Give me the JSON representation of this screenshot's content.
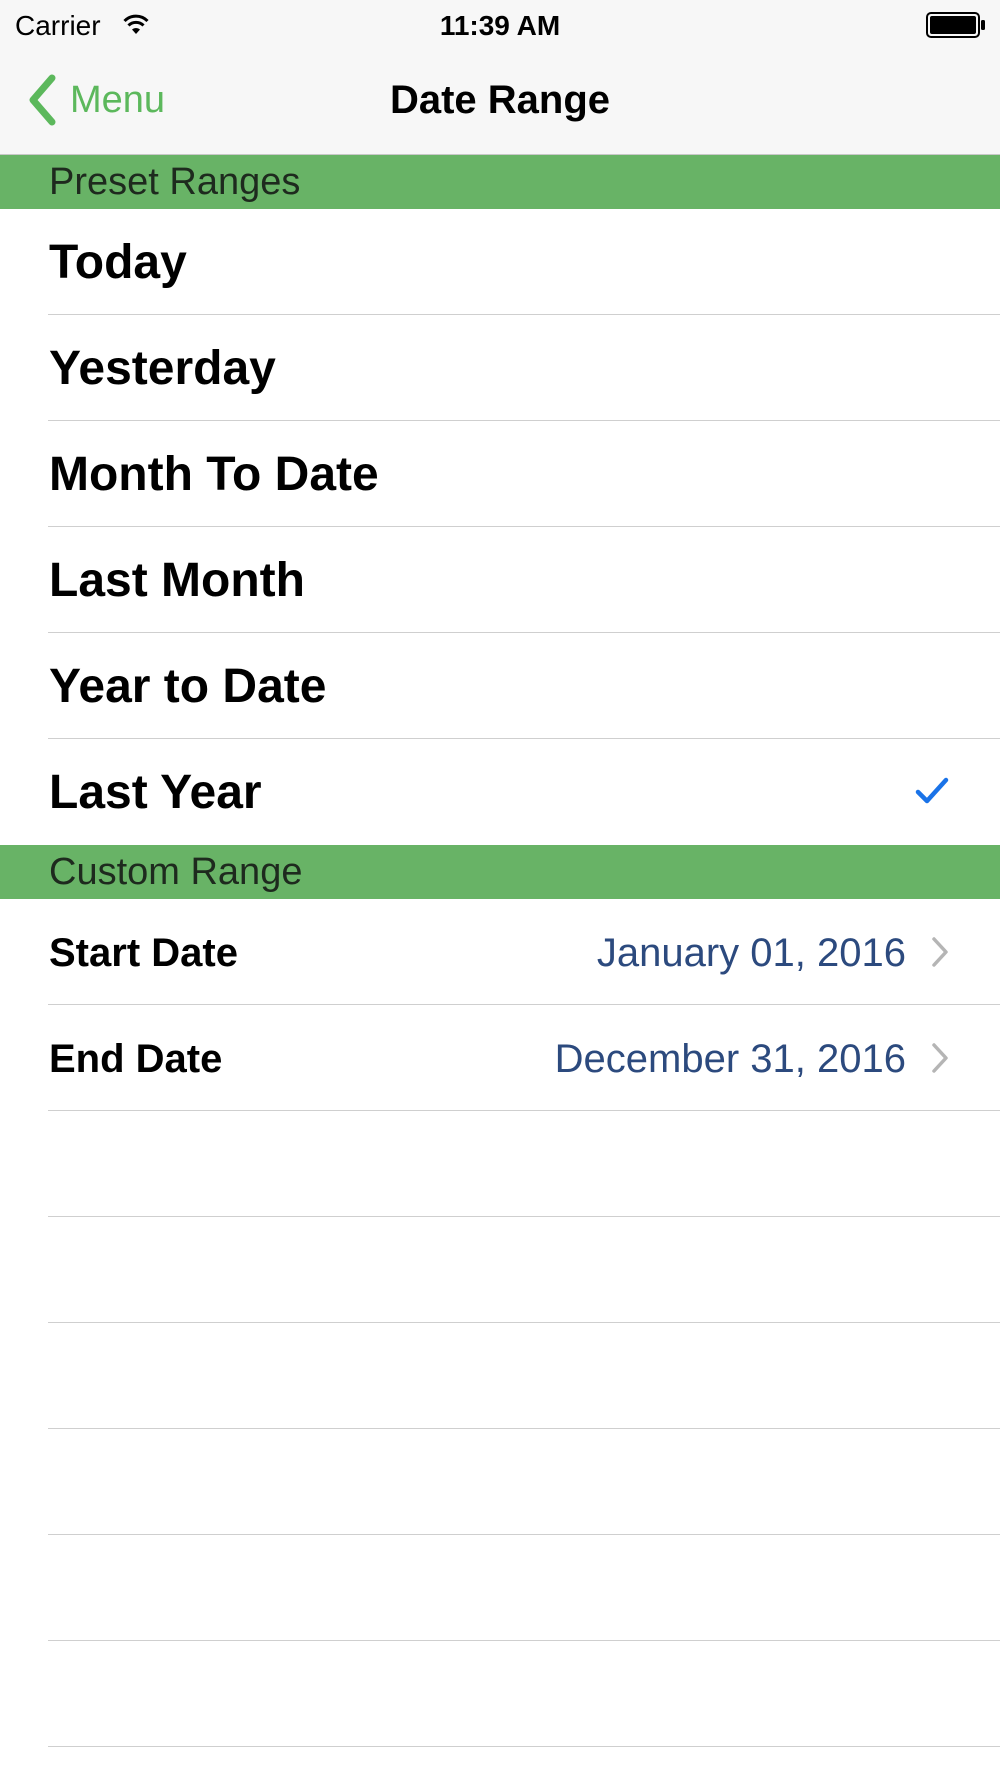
{
  "status_bar": {
    "carrier": "Carrier",
    "time": "11:39 AM"
  },
  "nav": {
    "back_label": "Menu",
    "title": "Date Range"
  },
  "colors": {
    "accent_green": "#5cb85c",
    "section_green": "#68b366",
    "checkmark_blue": "#1a73e8",
    "value_blue": "#2c4a7e"
  },
  "preset_section": {
    "header": "Preset Ranges",
    "items": [
      {
        "label": "Today",
        "selected": false
      },
      {
        "label": "Yesterday",
        "selected": false
      },
      {
        "label": "Month To Date",
        "selected": false
      },
      {
        "label": "Last Month",
        "selected": false
      },
      {
        "label": "Year to Date",
        "selected": false
      },
      {
        "label": "Last Year",
        "selected": true
      }
    ]
  },
  "custom_section": {
    "header": "Custom Range",
    "start": {
      "label": "Start Date",
      "value": "January 01, 2016"
    },
    "end": {
      "label": "End Date",
      "value": "December 31, 2016"
    }
  },
  "icons": {
    "back": "chevron-left-icon",
    "selected": "checkmark-icon",
    "disclosure": "chevron-right-icon",
    "wifi": "wifi-icon",
    "battery": "battery-icon"
  }
}
